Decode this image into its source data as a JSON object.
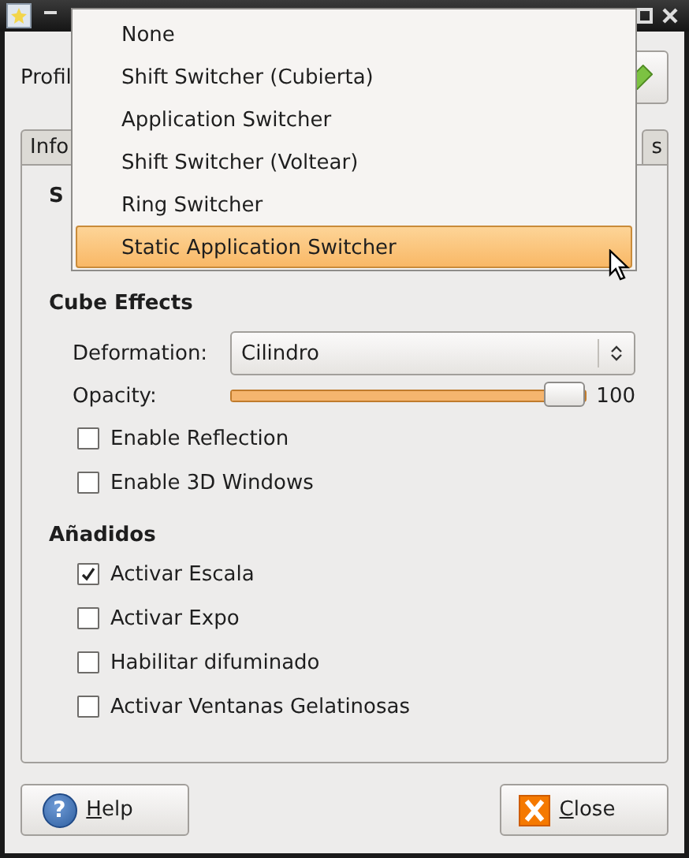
{
  "profile": {
    "label": "Profil"
  },
  "tabs": [
    {
      "label": "Info",
      "selected": false
    },
    {
      "label": "s",
      "selected": false
    }
  ],
  "sections": [
    {
      "heading": "S"
    },
    {
      "heading": "Cube Effects",
      "rows": [
        {
          "kind": "combo",
          "label": "Deformation:",
          "value": "Cilindro"
        },
        {
          "kind": "slider",
          "label": "Opacity:",
          "level": 1,
          "reading": "100"
        },
        {
          "kind": "check",
          "label": "Enable Reflection",
          "checked": false
        },
        {
          "kind": "check",
          "label": "Enable 3D Windows",
          "checked": false
        }
      ]
    },
    {
      "heading": "Añadidos",
      "rows": [
        {
          "kind": "check",
          "label": "Activar Escala",
          "checked": true
        },
        {
          "kind": "check",
          "label": "Activar Expo",
          "checked": false
        },
        {
          "kind": "check",
          "label": "Habilitar difuminado",
          "checked": false
        },
        {
          "kind": "check",
          "label": "Activar Ventanas Gelatinosas",
          "checked": false
        }
      ]
    }
  ],
  "buttons": [
    {
      "kind": "help",
      "label": "Help",
      "icon_text": "?"
    },
    {
      "kind": "close",
      "label": "Close"
    }
  ],
  "menu": {
    "items": [
      {
        "label": "None",
        "selected": false
      },
      {
        "label": "Shift Switcher (Cubierta)",
        "selected": false
      },
      {
        "label": "Application Switcher",
        "selected": false
      },
      {
        "label": "Shift Switcher (Voltear)",
        "selected": false
      },
      {
        "label": "Ring Switcher",
        "selected": false
      },
      {
        "label": "Static Application Switcher",
        "selected": true
      }
    ]
  }
}
